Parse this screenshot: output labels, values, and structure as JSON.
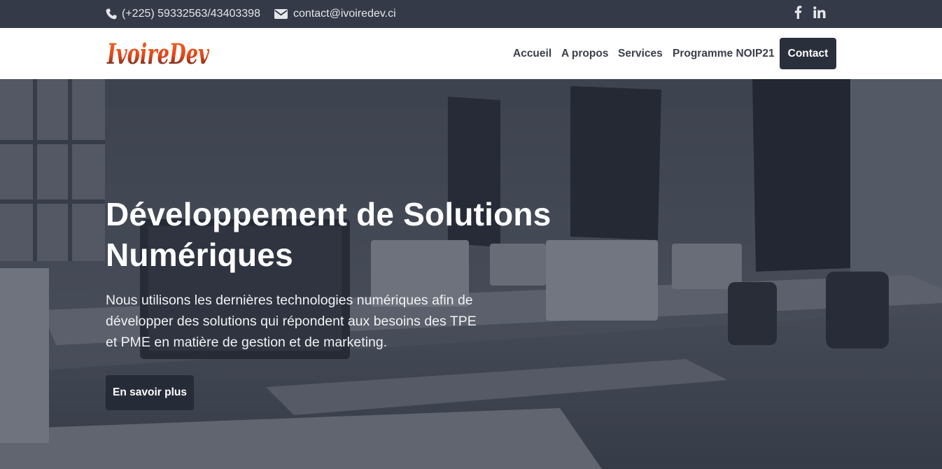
{
  "topbar": {
    "phone": "(+225) 59332563/43403398",
    "email": "contact@ivoiredev.ci",
    "icons": [
      "phone-icon",
      "envelope-icon",
      "facebook-icon",
      "linkedin-icon"
    ]
  },
  "navbar": {
    "logo_text": "IvoireDev",
    "links": [
      "Accueil",
      "A propos",
      "Services",
      "Programme NOIP21"
    ],
    "contact_button": "Contact"
  },
  "hero": {
    "title": "Développement de Solutions Numériques",
    "text": "Nous utilisons les dernières technologies numériques afin de développer des solutions qui répondent aux besoins des TPE et PME en matière de gestion et de marketing.",
    "button": "En savoir plus"
  },
  "colors": {
    "topbar_bg": "#343a47",
    "navbar_bg": "#ffffff",
    "nav_text": "#3a3f4a",
    "button_bg": "#2a303b",
    "logo_accent": "#e8481c"
  }
}
